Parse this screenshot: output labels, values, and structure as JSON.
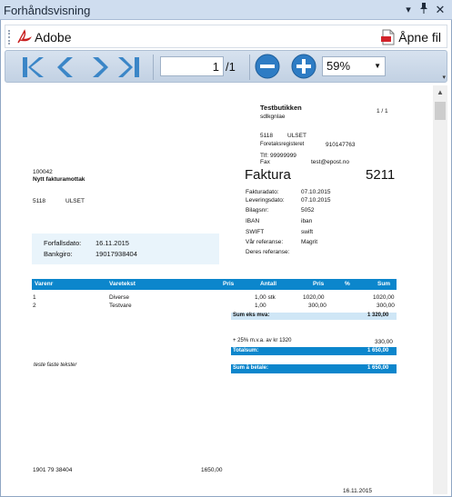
{
  "panel": {
    "title": "Forhåndsvisning",
    "buttons": [
      "chevron-down-icon",
      "pin-icon",
      "close-icon"
    ]
  },
  "adobebar": {
    "label": "Adobe",
    "open_file": "Åpne fil"
  },
  "viewer": {
    "page_value": "1",
    "page_total": "/1",
    "zoom": "59%"
  },
  "invoice": {
    "shop_name": "Testbutikken",
    "shop_sub": "sdlkgnlae",
    "page_counter": "1 / 1",
    "shop_zip": "5118",
    "shop_city": "ULSET",
    "org_label": "Foretaksregisteret",
    "org_value": "910147763",
    "tlf_label": "Tlf:",
    "tlf_value": "99999999",
    "fax_label": "Fax",
    "email": "test@epost.no",
    "customer_no": "100042",
    "customer_name": "Nytt fakturamottak",
    "customer_zip": "5118",
    "customer_city": "ULSET",
    "title": "Faktura",
    "number": "5211",
    "meta": [
      {
        "label": "Fakturadato:",
        "value": "07.10.2015"
      },
      {
        "label": "Leveringsdato:",
        "value": "07.10.2015"
      },
      {
        "label": "Bilagsnr:",
        "value": "5052"
      },
      {
        "label": "IBAN",
        "value": "iban"
      },
      {
        "label": "SWIFT",
        "value": "swift"
      },
      {
        "label": "Vår referanse:",
        "value": "Magrit"
      },
      {
        "label": "Deres referanse:",
        "value": ""
      }
    ],
    "due_label": "Forfallsdato:",
    "due_value": "16.11.2015",
    "giro_label": "Bankgiro:",
    "giro_value": "19017938404",
    "columns": [
      "Varenr",
      "Varetekst",
      "Pris",
      "Antall",
      "Pris",
      "%",
      "Sum"
    ],
    "rows": [
      {
        "no": "1",
        "text": "Diverse",
        "qty": "1,00 stk",
        "price": "1020,00",
        "sum": "1020,00"
      },
      {
        "no": "2",
        "text": "Testvare",
        "qty": "1,00",
        "price": "300,00",
        "sum": "300,00"
      }
    ],
    "sum_ex_label": "Sum eks mva:",
    "sum_ex_value": "1 320,00",
    "vat_line": "+ 25% m.v.a. av kr 1320",
    "vat_value": "330,00",
    "total_label": "Totalsum:",
    "total_value": "1 650,00",
    "pay_label": "Sum å betale:",
    "pay_value": "1 650,00",
    "fixed_text": "teste faste tekster",
    "footer_account": "1901 79 38404",
    "footer_amount": "1650,00",
    "footer_date": "16.11.2015"
  }
}
